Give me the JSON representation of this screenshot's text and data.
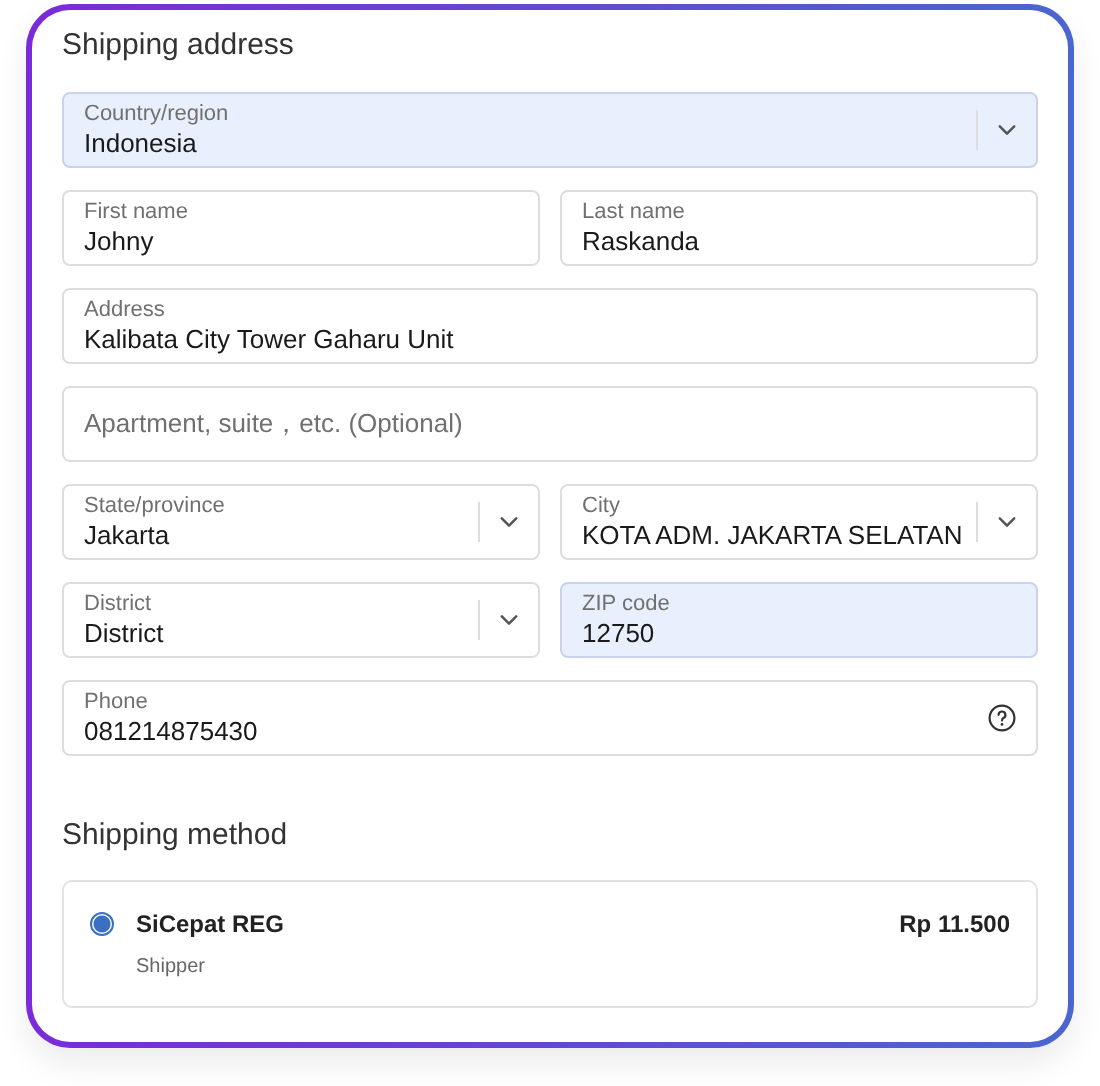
{
  "shipping_address": {
    "title": "Shipping address",
    "rows": [
      [
        {
          "kind": "select",
          "label": "Country/region",
          "value": "Indonesia",
          "autofilled": true
        }
      ],
      [
        {
          "kind": "text",
          "label": "First name",
          "value": "Johny",
          "autofilled": false
        },
        {
          "kind": "text",
          "label": "Last name",
          "value": "Raskanda",
          "autofilled": false
        }
      ],
      [
        {
          "kind": "text",
          "label": "Address",
          "value": "Kalibata City Tower Gaharu Unit",
          "autofilled": false
        }
      ],
      [
        {
          "kind": "text",
          "placeholder": "Apartment, suite，etc. (Optional)",
          "autofilled": false
        }
      ],
      [
        {
          "kind": "select",
          "label": "State/province",
          "value": "Jakarta",
          "autofilled": false
        },
        {
          "kind": "select",
          "label": "City",
          "value": "KOTA ADM. JAKARTA SELATAN",
          "autofilled": false
        }
      ],
      [
        {
          "kind": "select",
          "label": "District",
          "value": "District",
          "autofilled": false
        },
        {
          "kind": "text",
          "label": "ZIP code",
          "value": "12750",
          "autofilled": true
        }
      ],
      [
        {
          "kind": "text",
          "label": "Phone",
          "value": "081214875430",
          "autofilled": false,
          "help": true
        }
      ]
    ]
  },
  "shipping_method": {
    "title": "Shipping method",
    "options": [
      {
        "name": "SiCepat REG",
        "carrier": "Shipper",
        "price": "Rp 11.500",
        "selected": true
      }
    ]
  }
}
